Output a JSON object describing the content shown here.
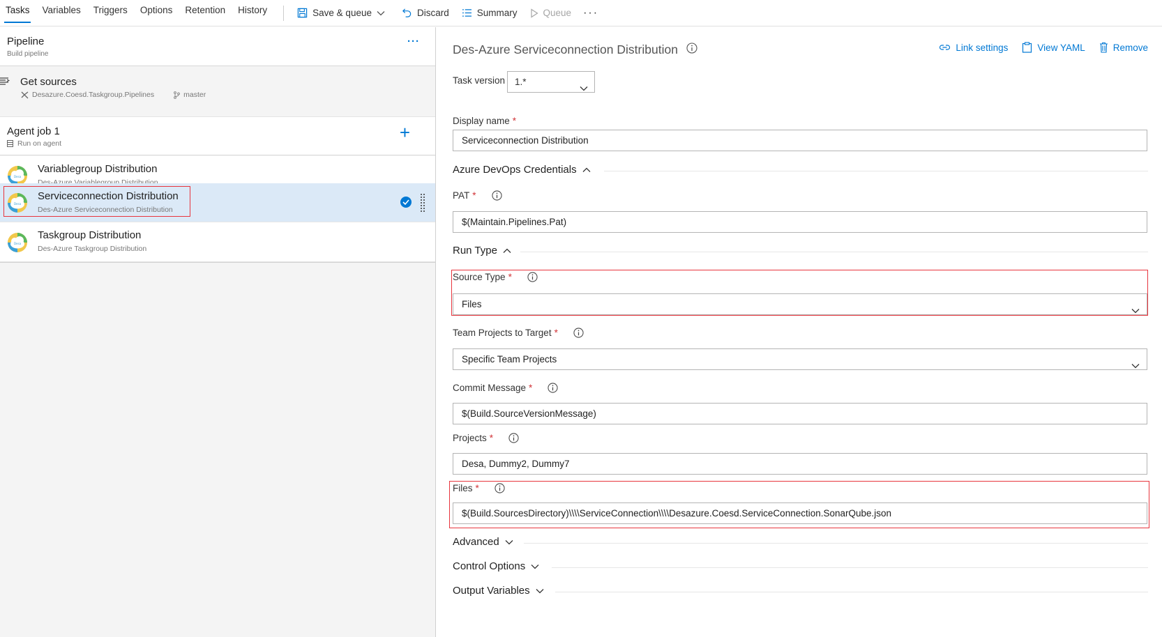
{
  "nav": {
    "tabs": [
      "Tasks",
      "Variables",
      "Triggers",
      "Options",
      "Retention",
      "History"
    ],
    "save_queue": "Save & queue",
    "discard": "Discard",
    "summary": "Summary",
    "queue": "Queue",
    "more": "···"
  },
  "pipeline": {
    "title": "Pipeline",
    "subtitle": "Build pipeline",
    "more": "···"
  },
  "sources": {
    "title": "Get sources",
    "repo": "Desazure.Coesd.Taskgroup.Pipelines",
    "branch": "master"
  },
  "agent": {
    "title": "Agent job 1",
    "subtitle": "Run on agent"
  },
  "tasks": [
    {
      "title": "Variablegroup Distribution",
      "subtitle": "Des-Azure Variablegroup Distribution",
      "selected": false
    },
    {
      "title": "Serviceconnection Distribution",
      "subtitle": "Des-Azure Serviceconnection Distribution",
      "selected": true
    },
    {
      "title": "Taskgroup Distribution",
      "subtitle": "Des-Azure Taskgroup Distribution",
      "selected": false
    }
  ],
  "detail": {
    "title": "Des-Azure Serviceconnection Distribution",
    "link_settings": "Link settings",
    "view_yaml": "View YAML",
    "remove": "Remove",
    "task_version_label": "Task version",
    "task_version": "1.*",
    "display_name_label": "Display name",
    "display_name": "Serviceconnection Distribution",
    "section_credentials": "Azure DevOps Credentials",
    "pat_label": "PAT",
    "pat": "$(Maintain.Pipelines.Pat)",
    "section_run_type": "Run Type",
    "source_type_label": "Source Type",
    "source_type": "Files",
    "team_projects_label": "Team Projects to Target",
    "team_projects": "Specific Team Projects",
    "commit_message_label": "Commit Message",
    "commit_message": "$(Build.SourceVersionMessage)",
    "projects_label": "Projects",
    "projects": "Desa, Dummy2, Dummy7",
    "files_label": "Files",
    "files": "$(Build.SourcesDirectory)\\\\\\\\ServiceConnection\\\\\\\\Desazure.Coesd.ServiceConnection.SonarQube.json",
    "section_advanced": "Advanced",
    "section_control": "Control Options",
    "section_output": "Output Variables",
    "required_mark": "*"
  },
  "colors": {
    "accent": "#0078d4",
    "highlight": "#e8353d",
    "selected_row": "#dbe9f7"
  }
}
